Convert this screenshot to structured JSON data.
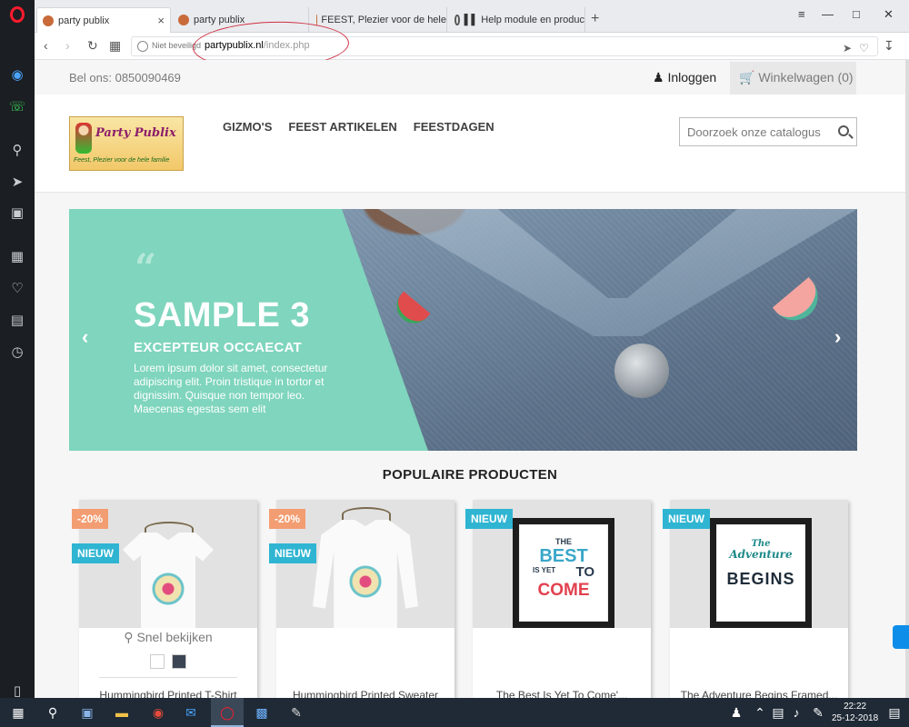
{
  "browser": {
    "tabs": [
      {
        "label": "party publix",
        "active": true
      },
      {
        "label": "party publix",
        "active": false
      },
      {
        "label": "FEEST, Plezier voor de hele",
        "active": false
      },
      {
        "label": "▌▌ Help module en produc",
        "active": false
      }
    ],
    "address": {
      "security": "Niet beveiligd",
      "domain": "partypublix.nl",
      "path": "/index.php"
    }
  },
  "site": {
    "phone": "Bel ons: 0850090469",
    "login": "Inloggen",
    "cart": "Winkelwagen (0)",
    "logo_text": "Party Publix",
    "logo_sub": "Feest, Plezier voor de hele familie",
    "nav": [
      "GIZMO'S",
      "FEEST ARTIKELEN",
      "FEESTDAGEN"
    ],
    "search_placeholder": "Doorzoek onze catalogus"
  },
  "slider": {
    "quote": "“",
    "title": "SAMPLE 3",
    "subtitle": "EXCEPTEUR OCCAECAT",
    "text": "Lorem ipsum dolor sit amet, consectetur adipiscing elit. Proin tristique in tortor et dignissim. Quisque non tempor leo. Maecenas egestas sem elit",
    "prev": "‹",
    "next": "›"
  },
  "products_section": {
    "title": "POPULAIRE PRODUCTEN",
    "quick_view": "Snel bekijken",
    "items": [
      {
        "name": "Hummingbird Printed T-Shirt",
        "badges": [
          "-20%",
          "NIEUW"
        ],
        "colors": [
          "#ffffff",
          "#3b4553"
        ]
      },
      {
        "name": "Hummingbird Printed Sweater",
        "badges": [
          "-20%",
          "NIEUW"
        ]
      },
      {
        "name": "The Best Is Yet To Come'...",
        "badges": [
          "NIEUW"
        ],
        "poster": [
          "THE",
          "BEST",
          "IS YET",
          "TO",
          "COME"
        ]
      },
      {
        "name": "The Adventure Begins Framed...",
        "badges": [
          "NIEUW"
        ],
        "poster": [
          "The",
          "Adventure",
          "BEGINS"
        ]
      }
    ]
  },
  "taskbar": {
    "time": "22:22",
    "date": "25-12-2018"
  }
}
